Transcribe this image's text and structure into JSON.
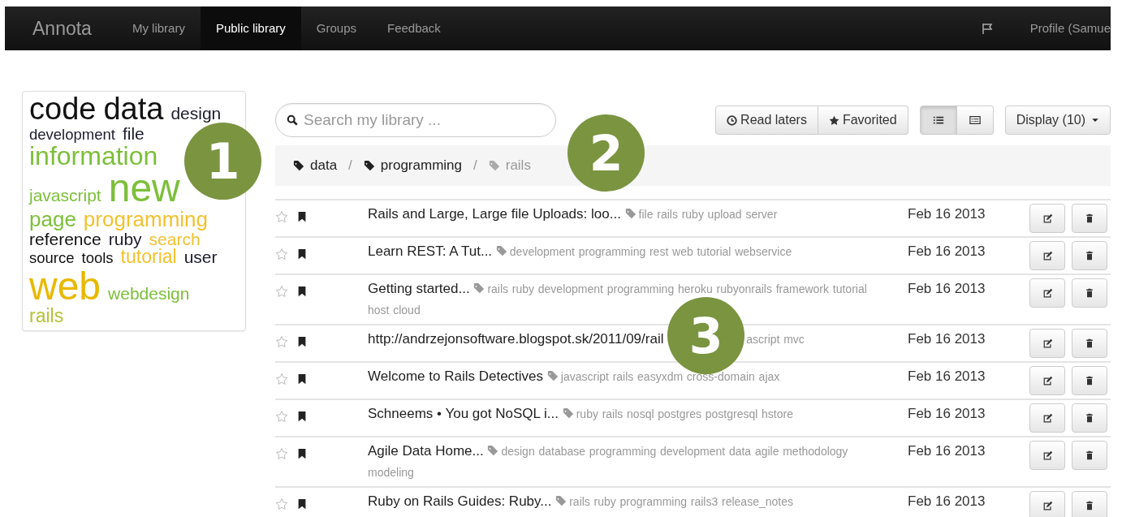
{
  "navbar": {
    "brand": "Annota",
    "items": [
      {
        "label": "My library",
        "selected": false
      },
      {
        "label": "Public library",
        "selected": true
      },
      {
        "label": "Groups",
        "selected": false
      },
      {
        "label": "Feedback",
        "selected": false
      }
    ],
    "profile": "Profile (Samue"
  },
  "tag_cloud": [
    {
      "word": "code",
      "color": "#111111",
      "kind": "big"
    },
    {
      "word": "data",
      "color": "#111111",
      "kind": "big"
    },
    {
      "word": "design",
      "color": "#1c1c2c",
      "kind": "small"
    },
    {
      "word": "development",
      "color": "#1c1c2c",
      "kind": "tiny"
    },
    {
      "word": "file",
      "color": "#1c1c2c",
      "kind": "small"
    },
    {
      "word": "information",
      "color": "#7cbf3a",
      "kind": "large"
    },
    {
      "word": "javascript",
      "color": "#7cbf3a",
      "kind": "small"
    },
    {
      "word": "new",
      "color": "#7cbf3a",
      "kind": "huge"
    },
    {
      "word": "page",
      "color": "#7cbf3a",
      "kind": "medium"
    },
    {
      "word": "programming",
      "color": "#f2c12e",
      "kind": "medium"
    },
    {
      "word": "reference",
      "color": "#111111",
      "kind": "small"
    },
    {
      "word": "ruby",
      "color": "#1c1c2c",
      "kind": "small"
    },
    {
      "word": "search",
      "color": "#f2c12e",
      "kind": "small"
    },
    {
      "word": "source",
      "color": "#111111",
      "kind": "tiny"
    },
    {
      "word": "tools",
      "color": "#111111",
      "kind": "tiny"
    },
    {
      "word": "tutorial",
      "color": "#f2c12e",
      "kind": "regular"
    },
    {
      "word": "user",
      "color": "#1c1c2c",
      "kind": "small"
    },
    {
      "word": "web",
      "color": "#e8b800",
      "kind": "huge"
    },
    {
      "word": "webdesign",
      "color": "#7cbf3a",
      "kind": "small"
    },
    {
      "word": "rails",
      "color": "#b5c235",
      "kind": "regular"
    }
  ],
  "search": {
    "placeholder": "Search my library ..."
  },
  "filters": [
    {
      "label": "Read laters"
    },
    {
      "label": "Favorited"
    }
  ],
  "views": [
    {
      "kind": "list",
      "selected": true
    },
    {
      "kind": "detail",
      "selected": false
    }
  ],
  "display": {
    "label": "Display (10)"
  },
  "breadcrumb": [
    {
      "label": "data",
      "active": false,
      "divider": "/"
    },
    {
      "label": "programming",
      "active": false,
      "divider": "/"
    },
    {
      "label": "rails",
      "active": true
    }
  ],
  "rows": [
    {
      "starred": false,
      "bookmarked": true,
      "title": "Rails and Large, Large file Uploads: loo...",
      "tags": [
        "file",
        "rails",
        "ruby",
        "upload",
        "server"
      ],
      "date": "Feb 16 2013"
    },
    {
      "starred": false,
      "bookmarked": true,
      "title": "Learn REST: A Tut...",
      "tags": [
        "development",
        "programming",
        "rest",
        "web",
        "tutorial",
        "webservice"
      ],
      "date": "Feb 16 2013"
    },
    {
      "starred": false,
      "bookmarked": true,
      "title": "Getting started...",
      "tags": [
        "rails",
        "ruby",
        "development",
        "programming",
        "heroku",
        "rubyonrails",
        "framework",
        "tutorial",
        "host",
        "cloud"
      ],
      "date": "Feb 16 2013"
    },
    {
      "starred": false,
      "bookmarked": true,
      "title": "http://andrzejonsoftware.blogspot.sk/2011/09/rail",
      "callout": "3",
      "tags": [
        "ascript",
        "mvc"
      ],
      "date": "Feb 16 2013"
    },
    {
      "starred": false,
      "bookmarked": true,
      "title": "Welcome to Rails Detectives",
      "tags": [
        "javascript",
        "rails",
        "easyxdm",
        "cross-domain",
        "ajax"
      ],
      "date": "Feb 16 2013"
    },
    {
      "starred": false,
      "bookmarked": true,
      "title": "Schneems • You got NoSQL i...",
      "tags": [
        "ruby",
        "rails",
        "nosql",
        "postgres",
        "postgresql",
        "hstore"
      ],
      "date": "Feb 16 2013"
    },
    {
      "starred": false,
      "bookmarked": true,
      "title": "Agile Data Home...",
      "tags": [
        "design",
        "database",
        "programming",
        "development",
        "data",
        "agile",
        "methodology",
        "modeling"
      ],
      "date": "Feb 16 2013"
    },
    {
      "starred": false,
      "bookmarked": true,
      "title": "Ruby on Rails Guides: Ruby...",
      "tags": [
        "rails",
        "ruby",
        "programming",
        "rails3",
        "release_notes"
      ],
      "date": "Feb 16 2013"
    }
  ],
  "callouts": [
    {
      "number": "1"
    },
    {
      "number": "2"
    }
  ]
}
